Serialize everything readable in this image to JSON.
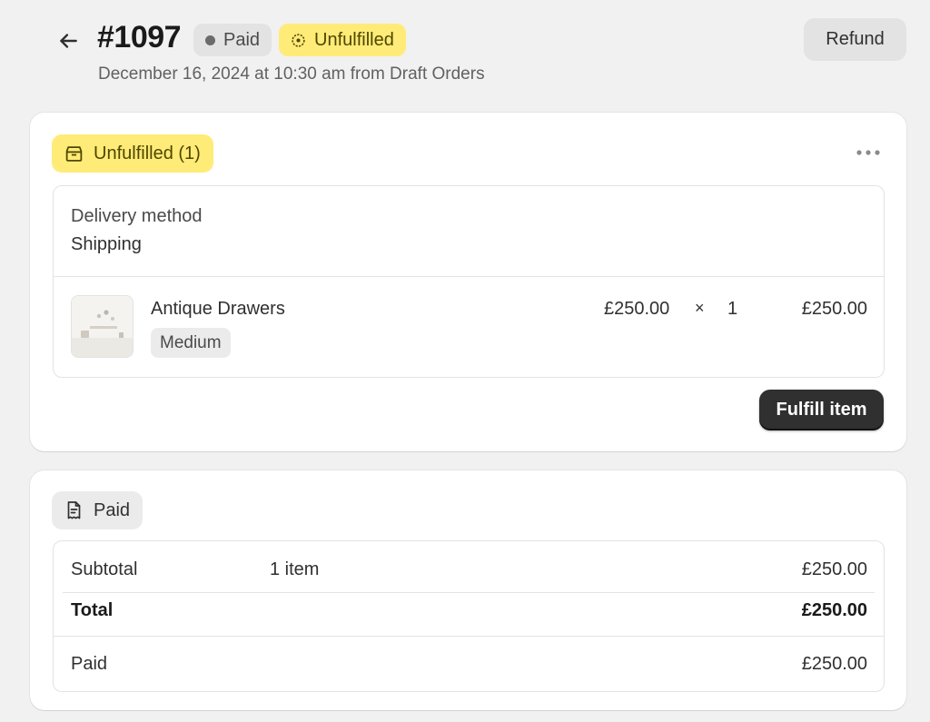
{
  "header": {
    "order_number": "#1097",
    "payment_status": "Paid",
    "fulfillment_status": "Unfulfilled",
    "meta": "December 16, 2024 at 10:30 am from Draft Orders",
    "refund_label": "Refund"
  },
  "fulfillment": {
    "badge_label": "Unfulfilled (1)",
    "delivery_label": "Delivery method",
    "delivery_value": "Shipping",
    "item": {
      "name": "Antique Drawers",
      "variant": "Medium",
      "unit_price": "£250.00",
      "times": "×",
      "quantity": "1",
      "total": "£250.00"
    },
    "fulfill_button": "Fulfill item"
  },
  "payment": {
    "badge_label": "Paid",
    "rows": [
      {
        "label": "Subtotal",
        "mid": "1 item",
        "amount": "£250.00"
      },
      {
        "label": "Total",
        "mid": "",
        "amount": "£250.00"
      },
      {
        "label": "Paid",
        "mid": "",
        "amount": "£250.00"
      }
    ]
  },
  "colors": {
    "page_bg": "#f1f1f1",
    "unfulfilled_badge": "#ffeb78",
    "paid_badge": "#e3e3e3",
    "primary_button": "#303030"
  }
}
